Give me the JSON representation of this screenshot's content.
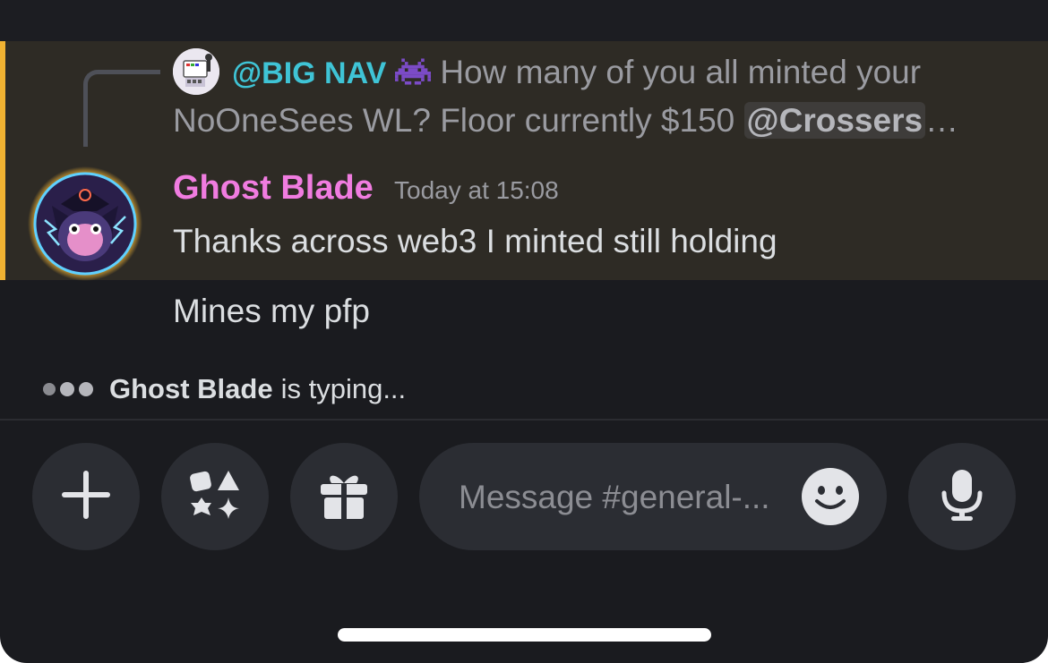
{
  "reply_preview": {
    "author": "@BIG NAV",
    "author_emoji": "space-invader-icon",
    "text_line1": "How many of you all minted your",
    "text_line2": "NoOneSees WL?   Floor currently $150",
    "mention": "@Crossers",
    "ellipsis": "…"
  },
  "message": {
    "author": "Ghost Blade",
    "timestamp": "Today at 15:08",
    "text": "Thanks across web3 I minted still holding",
    "followup": "Mines my pfp"
  },
  "typing_indicator": {
    "name": "Ghost Blade",
    "text": "is typing..."
  },
  "composer": {
    "placeholder": "Message #general-...",
    "buttons": [
      "plus-icon",
      "apps-icon",
      "gift-icon",
      "emoji-icon",
      "microphone-icon"
    ]
  },
  "colors": {
    "accent_highlight": "#f0b232",
    "mention_author": "#3fc4d6",
    "author_name": "#f07ce0",
    "background": "#1a1b1f"
  }
}
